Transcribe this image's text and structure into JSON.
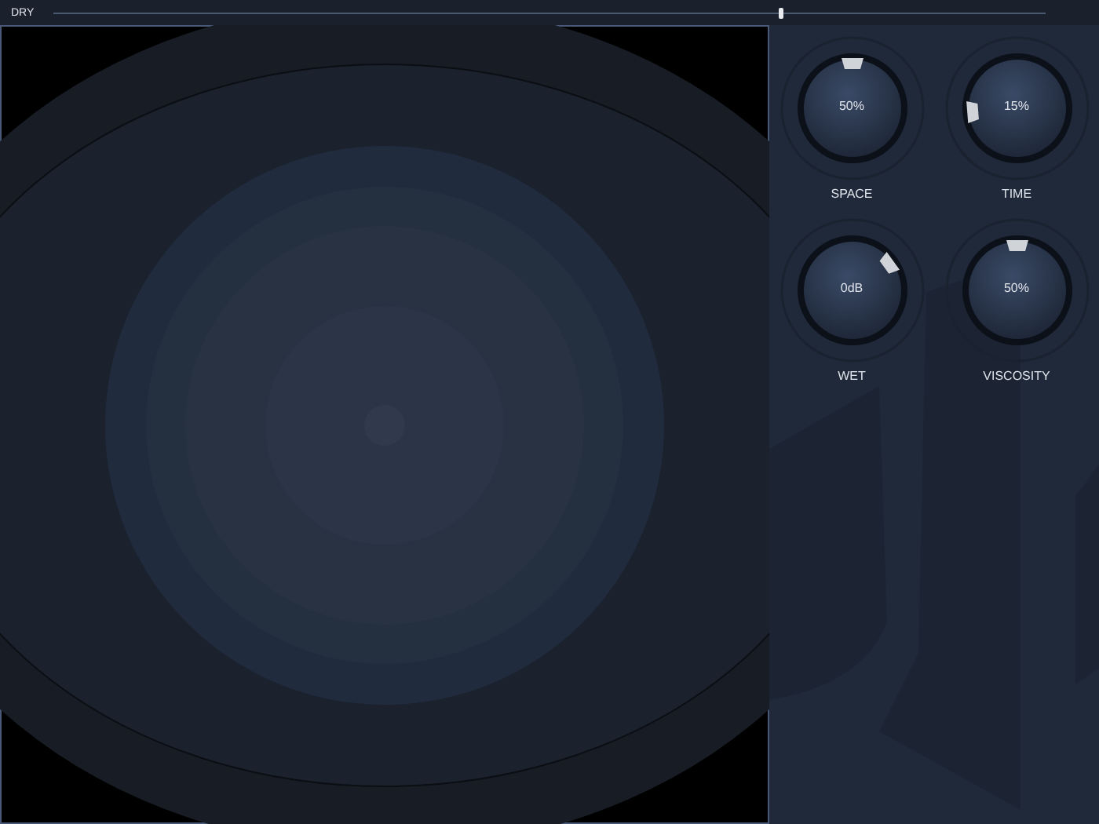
{
  "mix_slider": {
    "label": "DRY",
    "level": 0.734
  },
  "knobs": [
    {
      "label": "SPACE",
      "value": "50%",
      "level": 0.5
    },
    {
      "label": "TIME",
      "value": "15%",
      "level": 0.15
    },
    {
      "label": "WET",
      "value": "0dB",
      "level": 0.7
    },
    {
      "label": "VISCOSITY",
      "value": "50%",
      "level": 0.5
    }
  ]
}
